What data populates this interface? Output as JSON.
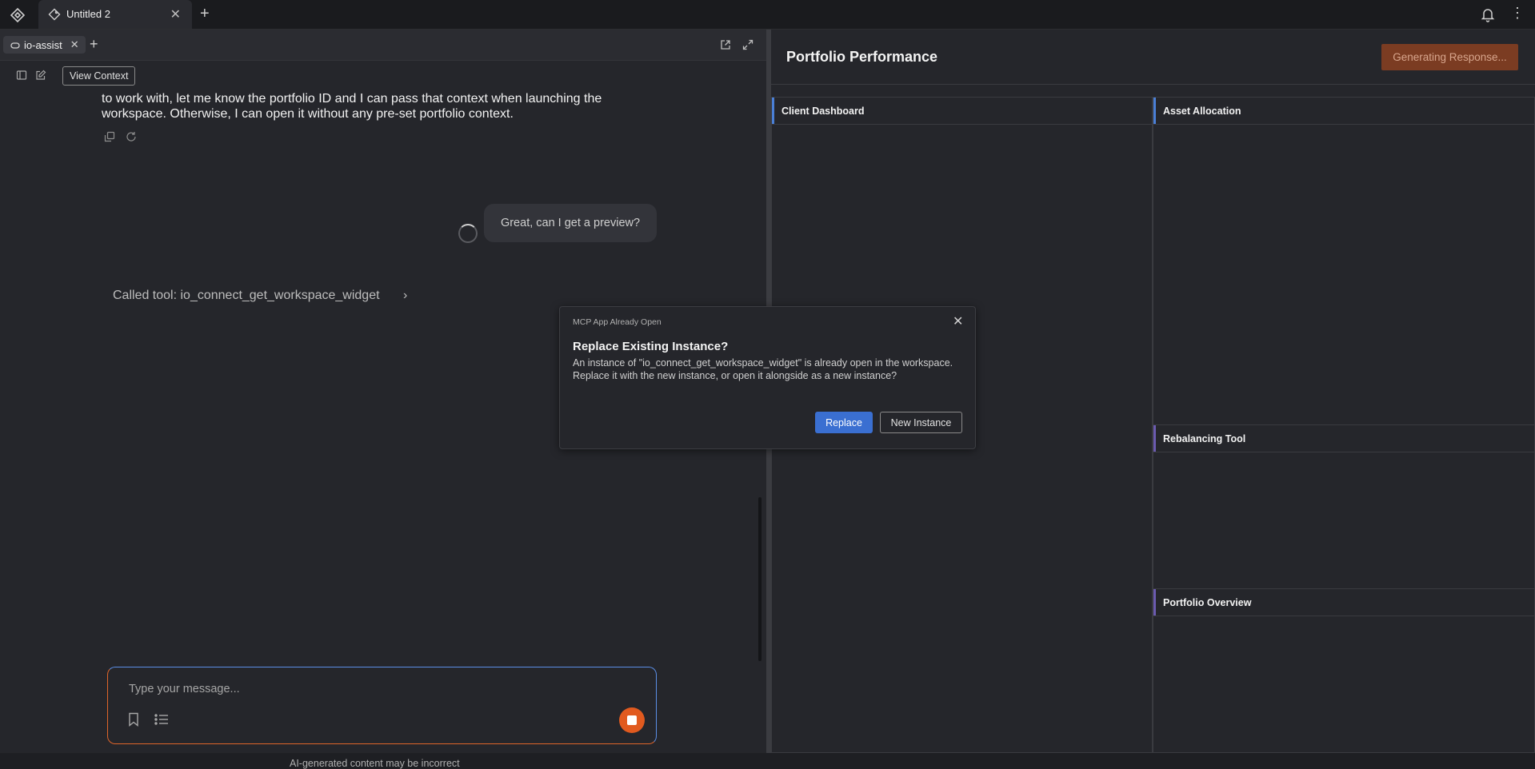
{
  "topbar": {
    "tab_title": "Untitled 2"
  },
  "chat": {
    "subtab_label": "io-assist",
    "view_context_label": "View Context",
    "assistant_message": "to work with, let me know the portfolio ID and I can pass that context when launching the workspace. Otherwise, I can open it without any pre-set portfolio context.",
    "user_message": "Great, can I get a preview?",
    "tool_call": "Called tool: io_connect_get_workspace_widget",
    "input_placeholder": "Type your message...",
    "disclaimer": "AI-generated content may be incorrect"
  },
  "workspace": {
    "title": "Portfolio Performance",
    "status_button": "Generating Response...",
    "widgets": [
      {
        "title": "Client Dashboard",
        "accent": "#4a7fd6"
      },
      {
        "title": "Asset Allocation",
        "accent": "#4a7fd6"
      },
      {
        "title": "Rebalancing Tool",
        "accent": "#6b5bb0"
      },
      {
        "title": "Portfolio Overview",
        "accent": "#6b5bb0"
      }
    ]
  },
  "modal": {
    "eyebrow": "MCP App Already Open",
    "title": "Replace Existing Instance?",
    "body": "An instance of \"io_connect_get_workspace_widget\" is already open in the workspace. Replace it with the new instance, or open it alongside as a new instance?",
    "replace_label": "Replace",
    "new_instance_label": "New Instance"
  },
  "colors": {
    "accent_blue": "#3a6fd1",
    "accent_orange": "#e15a1f"
  }
}
